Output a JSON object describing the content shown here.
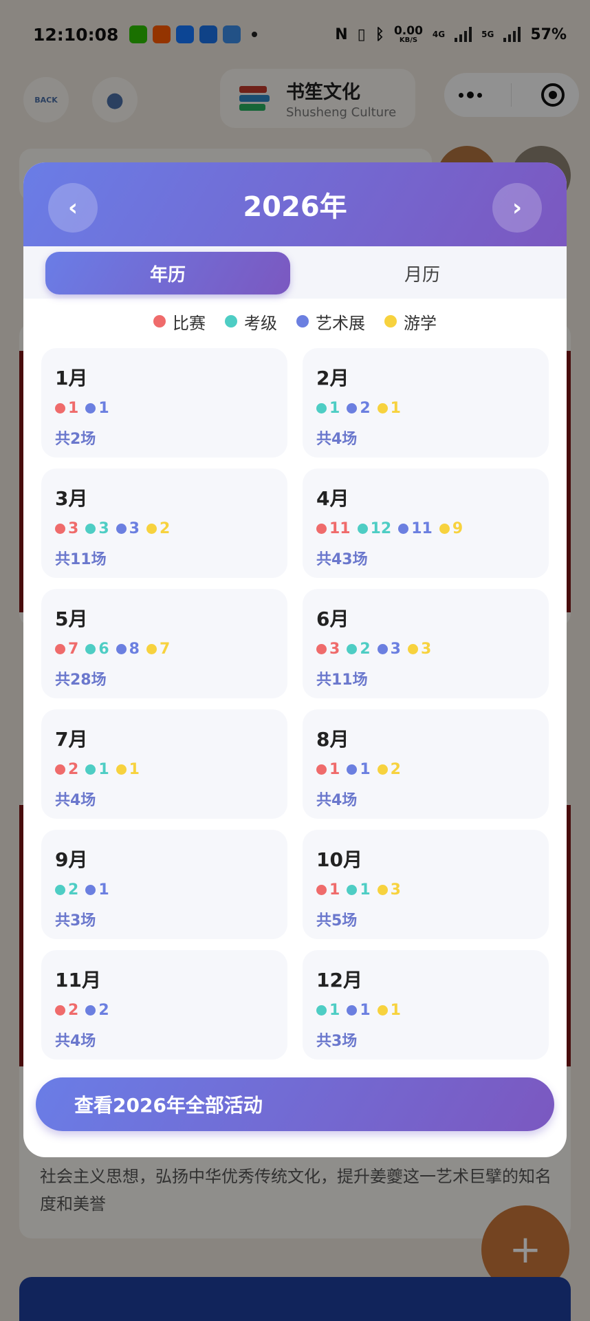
{
  "status_bar": {
    "time": "12:10:08",
    "net_speed": "0.00",
    "net_unit": "KB/S",
    "lte": "4G",
    "fiveg": "5G",
    "battery": "57%"
  },
  "nav": {
    "back_label": "BACK",
    "brand_cn": "书笙文化",
    "brand_en": "Shusheng Culture"
  },
  "modal": {
    "year_title": "2026年",
    "prev_label": "‹",
    "next_label": "›",
    "tabs": [
      {
        "label": "年历",
        "active": true
      },
      {
        "label": "月历",
        "active": false
      }
    ],
    "legend": [
      {
        "label": "比赛",
        "color": "#ef6b6b"
      },
      {
        "label": "考级",
        "color": "#4ecdc4"
      },
      {
        "label": "艺术展",
        "color": "#6b7fe0"
      },
      {
        "label": "游学",
        "color": "#f7d23e"
      }
    ],
    "months": [
      {
        "name": "1月",
        "counts": [
          {
            "type": 0,
            "value": "1"
          },
          {
            "type": 2,
            "value": "1"
          }
        ],
        "total": "共2场"
      },
      {
        "name": "2月",
        "counts": [
          {
            "type": 1,
            "value": "1"
          },
          {
            "type": 2,
            "value": "2"
          },
          {
            "type": 3,
            "value": "1"
          }
        ],
        "total": "共4场"
      },
      {
        "name": "3月",
        "counts": [
          {
            "type": 0,
            "value": "3"
          },
          {
            "type": 1,
            "value": "3"
          },
          {
            "type": 2,
            "value": "3"
          },
          {
            "type": 3,
            "value": "2"
          }
        ],
        "total": "共11场"
      },
      {
        "name": "4月",
        "counts": [
          {
            "type": 0,
            "value": "11"
          },
          {
            "type": 1,
            "value": "12"
          },
          {
            "type": 2,
            "value": "11"
          },
          {
            "type": 3,
            "value": "9"
          }
        ],
        "total": "共43场"
      },
      {
        "name": "5月",
        "counts": [
          {
            "type": 0,
            "value": "7"
          },
          {
            "type": 1,
            "value": "6"
          },
          {
            "type": 2,
            "value": "8"
          },
          {
            "type": 3,
            "value": "7"
          }
        ],
        "total": "共28场"
      },
      {
        "name": "6月",
        "counts": [
          {
            "type": 0,
            "value": "3"
          },
          {
            "type": 1,
            "value": "2"
          },
          {
            "type": 2,
            "value": "3"
          },
          {
            "type": 3,
            "value": "3"
          }
        ],
        "total": "共11场"
      },
      {
        "name": "7月",
        "counts": [
          {
            "type": 0,
            "value": "2"
          },
          {
            "type": 1,
            "value": "1"
          },
          {
            "type": 3,
            "value": "1"
          }
        ],
        "total": "共4场"
      },
      {
        "name": "8月",
        "counts": [
          {
            "type": 0,
            "value": "1"
          },
          {
            "type": 2,
            "value": "1"
          },
          {
            "type": 3,
            "value": "2"
          }
        ],
        "total": "共4场"
      },
      {
        "name": "9月",
        "counts": [
          {
            "type": 1,
            "value": "2"
          },
          {
            "type": 2,
            "value": "1"
          }
        ],
        "total": "共3场"
      },
      {
        "name": "10月",
        "counts": [
          {
            "type": 0,
            "value": "1"
          },
          {
            "type": 1,
            "value": "1"
          },
          {
            "type": 3,
            "value": "3"
          }
        ],
        "total": "共5场"
      },
      {
        "name": "11月",
        "counts": [
          {
            "type": 0,
            "value": "2"
          },
          {
            "type": 2,
            "value": "2"
          }
        ],
        "total": "共4场"
      },
      {
        "name": "12月",
        "counts": [
          {
            "type": 1,
            "value": "1"
          },
          {
            "type": 2,
            "value": "1"
          },
          {
            "type": 3,
            "value": "1"
          }
        ],
        "total": "共3场"
      }
    ],
    "view_all_label": "查看2026年全部活动"
  },
  "background": {
    "article_text": "社会主义思想，弘扬中华优秀传统文化，提升姜夔这一艺术巨擘的知名度和美誉",
    "fab_label": "+"
  }
}
